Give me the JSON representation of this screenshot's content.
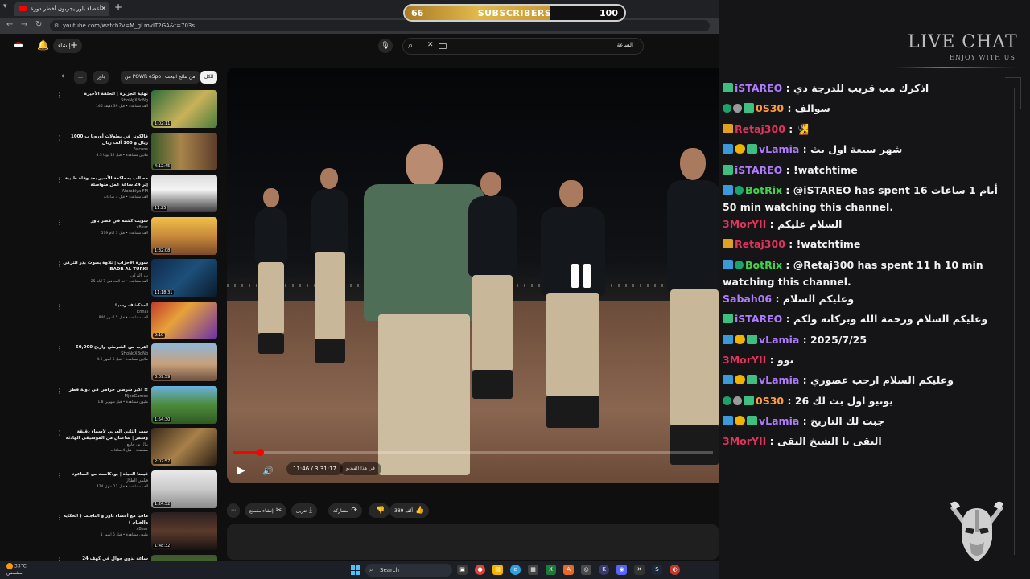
{
  "browser": {
    "tab_title": "أعضاء باور يجربون أخطر دورة",
    "url": "youtube.com/watch?v=M_gLmvIT2GA&t=703s"
  },
  "youtube": {
    "create_label": "إنشاء",
    "search_query": "الساعة",
    "chips": [
      "الكل",
      "من نتائج البحث",
      "من POWR eSports",
      "باور"
    ],
    "related": [
      {
        "title": "نهاية الجزيرة | الحلقة الأخيرة",
        "channel": "SHoNgXBoNg",
        "meta": "145 ألف مشاهدة • قبل 39 دقيقة",
        "duration": "1:02:11"
      },
      {
        "title": "فالكونز في بطولات أوروبا ب 1000 ريال و 100 ألف ريال",
        "channel": "Falcons",
        "meta": "8.5 ملايين مشاهدة • قبل 12 يومًا",
        "duration": "4:12:45"
      },
      {
        "title": "مطالب بمحاكمة الأسير بعد وفاة طبيبة إثر 24 ساعة عمل متواصلة",
        "channel": "Alarabiya FM",
        "meta": "ألف مشاهدة • قبل 3 ساعات",
        "duration": "11:25"
      },
      {
        "title": "سويت كشتة في قصر باور",
        "channel": "xBear",
        "meta": "579 ألف مشاهدة • قبل 3 أيام",
        "duration": "1:32:08"
      },
      {
        "title": "سورة الأحزاب | تلاوة بصوت بدر التركي BADR AL TURKI",
        "channel": "بدر التركي",
        "meta": "25 ألف مشاهدة • تم البث قبل 7 أيام",
        "duration": "11:18:31"
      },
      {
        "title": "استكشف رسيك",
        "channel": "Ennai",
        "meta": "846 ألف مشاهدة • قبل 5 أشهر",
        "duration": "9:10"
      },
      {
        "title": "اهرب من الشرطي واربح 50,000",
        "channel": "SHoNgXBoNg",
        "meta": "4.6 ملايين مشاهدة • قبل 5 أشهر",
        "duration": "3:09:59"
      },
      {
        "title": "اكبر شرطي حرامي في دولة قطر !!",
        "channel": "MjeeGames",
        "meta": "1.8 مليون مشاهدة • قبل شهرين",
        "duration": "1:54:30"
      },
      {
        "title": "سمر الثاني العربي لأسماء دقيقة وسمر | ساعتان من الموسيقى الهادئة",
        "channel": "بلال بن جامع",
        "meta": "مشاهدة • قبل 4 ساعات",
        "duration": "2:02:57"
      },
      {
        "title": "قيمنا الحياة | بودكاست مع الصاعود",
        "channel": "فيلمي الطلال",
        "meta": "424 ألف مشاهدة • قبل 11 شهرًا",
        "duration": "1:24:52"
      },
      {
        "title": "مافيا مع أعضاء باور و الناجيت ( الحكاية والختام )",
        "channel": "xBear",
        "meta": "1 مليون مشاهدة • قبل 5 أشهر",
        "duration": "1:48:32"
      },
      {
        "title": "24 ساعة بدون جوال في كهف",
        "channel": "",
        "meta": "",
        "duration": ""
      }
    ],
    "player": {
      "time": "11:46 / 3:31:17",
      "chapter": "في هذا الفيديو",
      "progress_fraction": 0.0557
    },
    "actions": {
      "likes": "389 ألف",
      "share": "مشاركة",
      "download": "تنزيل",
      "clip": "إنشاء مقطع"
    }
  },
  "taskbar": {
    "temperature": "33°C",
    "weather": "مشمس",
    "search": "Search"
  },
  "subscribers": {
    "current": "66",
    "label": "SUBSCRIBERS",
    "goal": "100",
    "progress_fraction": 0.66
  },
  "chat": {
    "title": "LIVE CHAT",
    "subtitle": "ENJOY WITH US",
    "messages": [
      {
        "badges": [
          "sub"
        ],
        "user": "iSTAREO",
        "color": "#b07cff",
        "text": "اذكرك مب قريب للدرجة ذي"
      },
      {
        "badges": [
          "verified",
          "grey",
          "sub"
        ],
        "user": "0S30",
        "color": "#ff9d3c",
        "text": "سوالف"
      },
      {
        "badges": [
          "crown"
        ],
        "user": "Retaj300",
        "color": "#e0345c",
        "text": "🧏"
      },
      {
        "badges": [
          "mod",
          "gold",
          "sub"
        ],
        "user": "vLamia",
        "color": "#b07cff",
        "text": "شهر سبعة اول بث"
      },
      {
        "badges": [
          "sub"
        ],
        "user": "iSTAREO",
        "color": "#b07cff",
        "text": "!watchtime"
      },
      {
        "badges": [
          "mod",
          "verified"
        ],
        "user": "BotRix",
        "color": "#3fd64a",
        "text": "@iSTAREO has spent 16 أيام 1 ساعات 50 min watching this channel."
      },
      {
        "badges": [],
        "user": "3MorYII",
        "color": "#e0345c",
        "text": "السلام عليكم"
      },
      {
        "badges": [
          "crown"
        ],
        "user": "Retaj300",
        "color": "#e0345c",
        "text": "!watchtime"
      },
      {
        "badges": [
          "mod",
          "verified"
        ],
        "user": "BotRix",
        "color": "#3fd64a",
        "text": "@Retaj300 has spent 11 h 10 min watching this channel."
      },
      {
        "badges": [],
        "user": "Sabah06",
        "color": "#b07cff",
        "text": "وعليكم السلام"
      },
      {
        "badges": [
          "sub"
        ],
        "user": "iSTAREO",
        "color": "#b07cff",
        "text": "وعليكم السلام ورحمة الله وبركاته ولكم"
      },
      {
        "badges": [
          "mod",
          "gold",
          "sub"
        ],
        "user": "vLamia",
        "color": "#b07cff",
        "text": "2025/7/25"
      },
      {
        "badges": [],
        "user": "3MorYII",
        "color": "#e0345c",
        "text": "توو"
      },
      {
        "badges": [
          "mod",
          "gold",
          "sub"
        ],
        "user": "vLamia",
        "color": "#b07cff",
        "text": "وعليكم السلام ارحب عصوري"
      },
      {
        "badges": [
          "verified",
          "grey",
          "sub"
        ],
        "user": "0S30",
        "color": "#ff9d3c",
        "text": "يونيو اول بث لك 26"
      },
      {
        "badges": [
          "mod",
          "gold",
          "sub"
        ],
        "user": "vLamia",
        "color": "#b07cff",
        "text": "جبت لك التاريخ"
      },
      {
        "badges": [],
        "user": "3MorYII",
        "color": "#e0345c",
        "text": "البقى يا الشيخ البقى"
      }
    ]
  },
  "colors": {
    "youtube_red": "#ff0000",
    "chat_bg": "#151517",
    "subs_fill": "#e1b84a"
  }
}
